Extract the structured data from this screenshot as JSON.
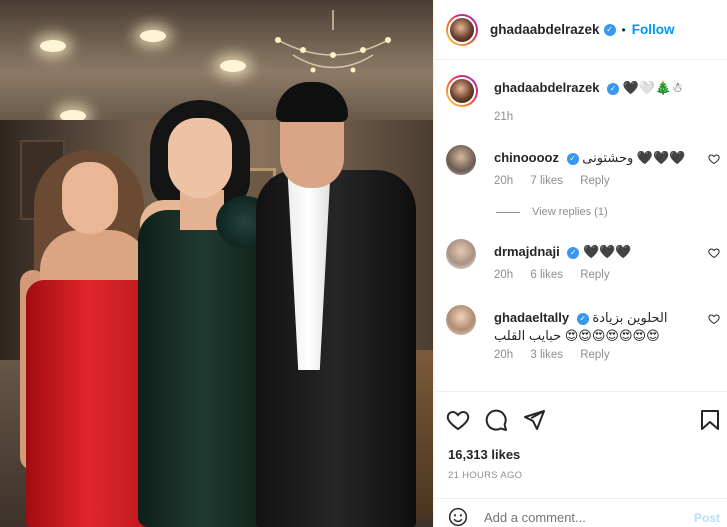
{
  "post": {
    "username": "ghadaabdelrazek",
    "follow_label": "Follow",
    "separator": "•",
    "caption": "🖤🤍🎄☃",
    "caption_time": "21h"
  },
  "comments": [
    {
      "user": "chinooooz",
      "text": "وحشتونى 🖤🖤🖤",
      "time": "20h",
      "likes": "7 likes",
      "reply": "Reply",
      "verified": true
    },
    {
      "user": "drmajdnaji",
      "text": "🖤🖤🖤",
      "time": "20h",
      "likes": "6 likes",
      "reply": "Reply",
      "verified": true
    },
    {
      "user": "ghadaeltally",
      "text": "الحلوين بزيادة حبايب القلب 😍😍😍😍😍😍😍",
      "time": "20h",
      "likes": "3 likes",
      "reply": "Reply",
      "verified": true
    }
  ],
  "view_replies": "View replies (1)",
  "likes_count": "16,313 likes",
  "posted_time": "21 HOURS AGO",
  "add_comment_placeholder": "Add a comment...",
  "post_button": "Post",
  "colors": {
    "accent": "#0095f6",
    "verified": "#3897f0",
    "muted": "#8e8e8e"
  }
}
